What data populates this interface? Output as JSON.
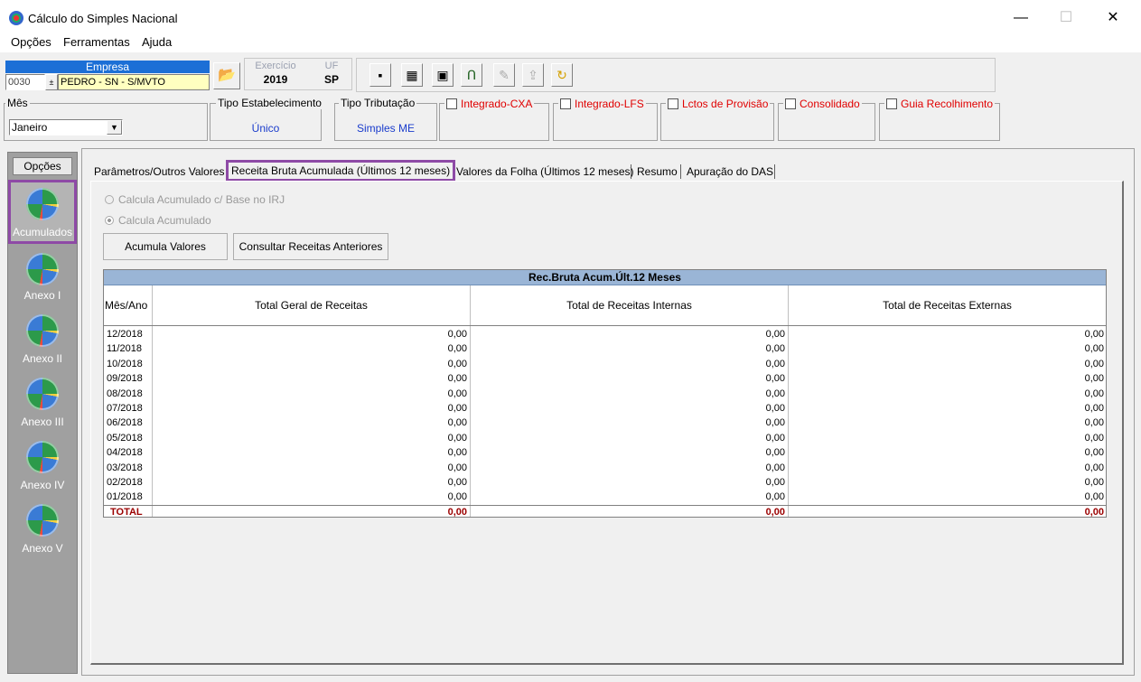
{
  "window": {
    "title": "Cálculo do Simples Nacional",
    "minimize": "—",
    "maximize": "☐",
    "close": "✕"
  },
  "menu": {
    "items": [
      "Opções",
      "Ferramentas",
      "Ajuda"
    ]
  },
  "empresa": {
    "label": "Empresa",
    "code": "0030",
    "name": "PEDRO - SN - S/MVTO"
  },
  "exercicio": {
    "label": "Exercício",
    "value": "2019"
  },
  "uf": {
    "label": "UF",
    "value": "SP"
  },
  "mes": {
    "label": "Mês",
    "value": "Janeiro"
  },
  "tipo_estabelecimento": {
    "label": "Tipo Estabelecimento",
    "value": "Único"
  },
  "tipo_tributacao": {
    "label": "Tipo Tributação",
    "value": "Simples ME"
  },
  "checks": [
    {
      "label": "Integrado-CXA"
    },
    {
      "label": "Integrado-LFS"
    },
    {
      "label": "Lctos de Provisão"
    },
    {
      "label": "Consolidado"
    },
    {
      "label": "Guia Recolhimento"
    }
  ],
  "left_panel": {
    "header": "Opções",
    "items": [
      "Acumulados",
      "Anexo I",
      "Anexo II",
      "Anexo III",
      "Anexo IV",
      "Anexo V"
    ]
  },
  "tabs": [
    "Parâmetros/Outros Valores",
    "Receita Bruta Acumulada (Últimos 12 meses)",
    "Valores da Folha (Últimos 12 meses)",
    "Resumo",
    "Apuração do DAS"
  ],
  "options": {
    "radio1": "Calcula Acumulado c/ Base no IRJ",
    "radio2": "Calcula Acumulado"
  },
  "buttons": {
    "acumula": "Acumula Valores",
    "consultar": "Consultar Receitas Anteriores"
  },
  "grid": {
    "title": "Rec.Bruta Acum.Últ.12 Meses",
    "headers": [
      "Mês/Ano",
      "Total Geral de Receitas",
      "Total de Receitas Internas",
      "Total de Receitas Externas"
    ],
    "rows": [
      [
        "12/2018",
        "0,00",
        "0,00",
        "0,00"
      ],
      [
        "11/2018",
        "0,00",
        "0,00",
        "0,00"
      ],
      [
        "10/2018",
        "0,00",
        "0,00",
        "0,00"
      ],
      [
        "09/2018",
        "0,00",
        "0,00",
        "0,00"
      ],
      [
        "08/2018",
        "0,00",
        "0,00",
        "0,00"
      ],
      [
        "07/2018",
        "0,00",
        "0,00",
        "0,00"
      ],
      [
        "06/2018",
        "0,00",
        "0,00",
        "0,00"
      ],
      [
        "05/2018",
        "0,00",
        "0,00",
        "0,00"
      ],
      [
        "04/2018",
        "0,00",
        "0,00",
        "0,00"
      ],
      [
        "03/2018",
        "0,00",
        "0,00",
        "0,00"
      ],
      [
        "02/2018",
        "0,00",
        "0,00",
        "0,00"
      ],
      [
        "01/2018",
        "0,00",
        "0,00",
        "0,00"
      ]
    ],
    "total": [
      "TOTAL",
      "0,00",
      "0,00",
      "0,00"
    ]
  },
  "colors": {
    "highlight": "#8e4aa6",
    "accent_header": "#9ab5d6",
    "total_text": "#9b0000",
    "empresa_bar": "#1c6fd6"
  }
}
